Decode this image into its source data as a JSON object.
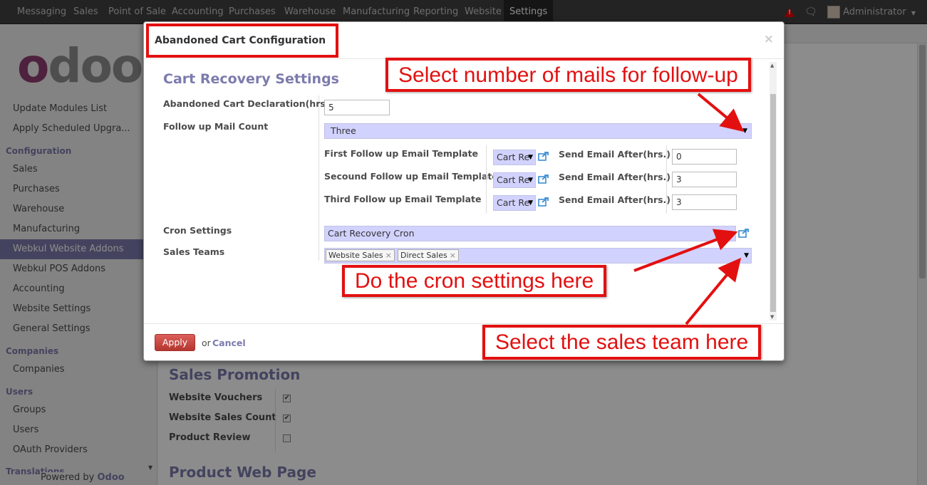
{
  "topbar": {
    "menu": [
      "Messaging",
      "Sales",
      "Point of Sale",
      "Accounting",
      "Purchases",
      "Warehouse",
      "Manufacturing",
      "Reporting",
      "Website",
      "Settings"
    ],
    "active": "Settings",
    "user": "Administrator"
  },
  "sidebar": {
    "logo": {
      "first": "o",
      "rest": "doo"
    },
    "items": [
      {
        "label": "Update Modules List"
      },
      {
        "label": "Apply Scheduled Upgra..."
      },
      {
        "label": "Configuration",
        "header": true
      },
      {
        "label": "Sales"
      },
      {
        "label": "Purchases"
      },
      {
        "label": "Warehouse"
      },
      {
        "label": "Manufacturing"
      },
      {
        "label": "Webkul Website Addons",
        "active": true
      },
      {
        "label": "Webkul POS Addons"
      },
      {
        "label": "Accounting"
      },
      {
        "label": "Website Settings"
      },
      {
        "label": "General Settings"
      },
      {
        "label": "Companies",
        "header": true
      },
      {
        "label": "Companies"
      },
      {
        "label": "Users",
        "header": true
      },
      {
        "label": "Groups"
      },
      {
        "label": "Users"
      },
      {
        "label": "OAuth Providers"
      },
      {
        "label": "Translations",
        "header": true
      }
    ],
    "powered_prefix": "Powered by ",
    "powered_brand": "Odoo"
  },
  "background": {
    "sales_promotion_title": "Sales Promotion",
    "website_vouchers": "Website Vouchers",
    "website_vouchers_checked": true,
    "website_sales_count": "Website Sales Count",
    "website_sales_count_checked": true,
    "product_review": "Product Review",
    "product_review_checked": false,
    "product_web_page_title": "Product Web Page"
  },
  "modal": {
    "title": "Abandoned Cart Configuration",
    "close": "×",
    "section_title": "Cart Recovery Settings",
    "abandoned_label": "Abandoned Cart Declaration(hrs.)",
    "abandoned_value": "5",
    "followup_label": "Follow up Mail Count",
    "followup_value": "Three",
    "templates": [
      {
        "label": "First Follow up Email Template",
        "value": "Cart Re",
        "send_label": "Send Email After(hrs.)",
        "send_value": "0"
      },
      {
        "label": "Secound Follow up Email Template",
        "value": "Cart Re",
        "send_label": "Send Email After(hrs.)",
        "send_value": "3"
      },
      {
        "label": "Third Follow up Email Template",
        "value": "Cart Re",
        "send_label": "Send Email After(hrs.)",
        "send_value": "3"
      }
    ],
    "cron_label": "Cron Settings",
    "cron_value": "Cart Recovery Cron",
    "teams_label": "Sales Teams",
    "teams": [
      "Website Sales",
      "Direct Sales"
    ],
    "apply": "Apply",
    "or": "or",
    "cancel": "Cancel"
  },
  "annotations": {
    "followup": "Select number of mails for follow-up",
    "cron": "Do the cron settings here",
    "teams": "Select the sales team here"
  },
  "colors": {
    "accent": "#7c7bad",
    "callout": "#e31010",
    "select_bg": "#d2d2ff",
    "apply_bg": "#c9302c"
  }
}
